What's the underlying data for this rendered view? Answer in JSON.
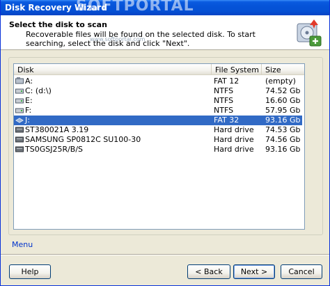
{
  "window": {
    "title": "Disk Recovery Wizard",
    "watermark": "SOFTPORTAL",
    "watermark_url": "www.softportal.com"
  },
  "header": {
    "title": "Select the disk to scan",
    "description": "Recoverable files will be found on the selected disk. To start searching, select the disk and click \"Next\"."
  },
  "list": {
    "columns": [
      "Disk",
      "File System",
      "Size"
    ],
    "rows": [
      {
        "disk": "A:",
        "fs": "FAT 12",
        "size": "(empty)",
        "icon": "floppy-drive-icon"
      },
      {
        "disk": "C: (d:\\)",
        "fs": "NTFS",
        "size": "74.52 Gb",
        "icon": "hard-drive-icon"
      },
      {
        "disk": "E:",
        "fs": "NTFS",
        "size": "16.60 Gb",
        "icon": "hard-drive-icon"
      },
      {
        "disk": "F:",
        "fs": "NTFS",
        "size": "57.95 Gb",
        "icon": "hard-drive-icon"
      },
      {
        "disk": "J:",
        "fs": "FAT 32",
        "size": "93.16 Gb",
        "icon": "removable-drive-icon",
        "selected": true
      },
      {
        "disk": "ST380021A 3.19",
        "fs": "Hard drive",
        "size": "74.53 Gb",
        "icon": "physical-disk-icon"
      },
      {
        "disk": "SAMSUNG SP0812C SU100-30",
        "fs": "Hard drive",
        "size": "74.56 Gb",
        "icon": "physical-disk-icon"
      },
      {
        "disk": "TS0GSJ25R/B/S",
        "fs": "Hard drive",
        "size": "93.16 Gb",
        "icon": "physical-disk-icon"
      }
    ]
  },
  "menu_label": "Menu",
  "buttons": {
    "help": "Help",
    "back": "< Back",
    "next": "Next >",
    "cancel": "Cancel"
  },
  "colors": {
    "selection": "#316ac5",
    "titlebar": "#0553d8",
    "link": "#0033cc"
  }
}
